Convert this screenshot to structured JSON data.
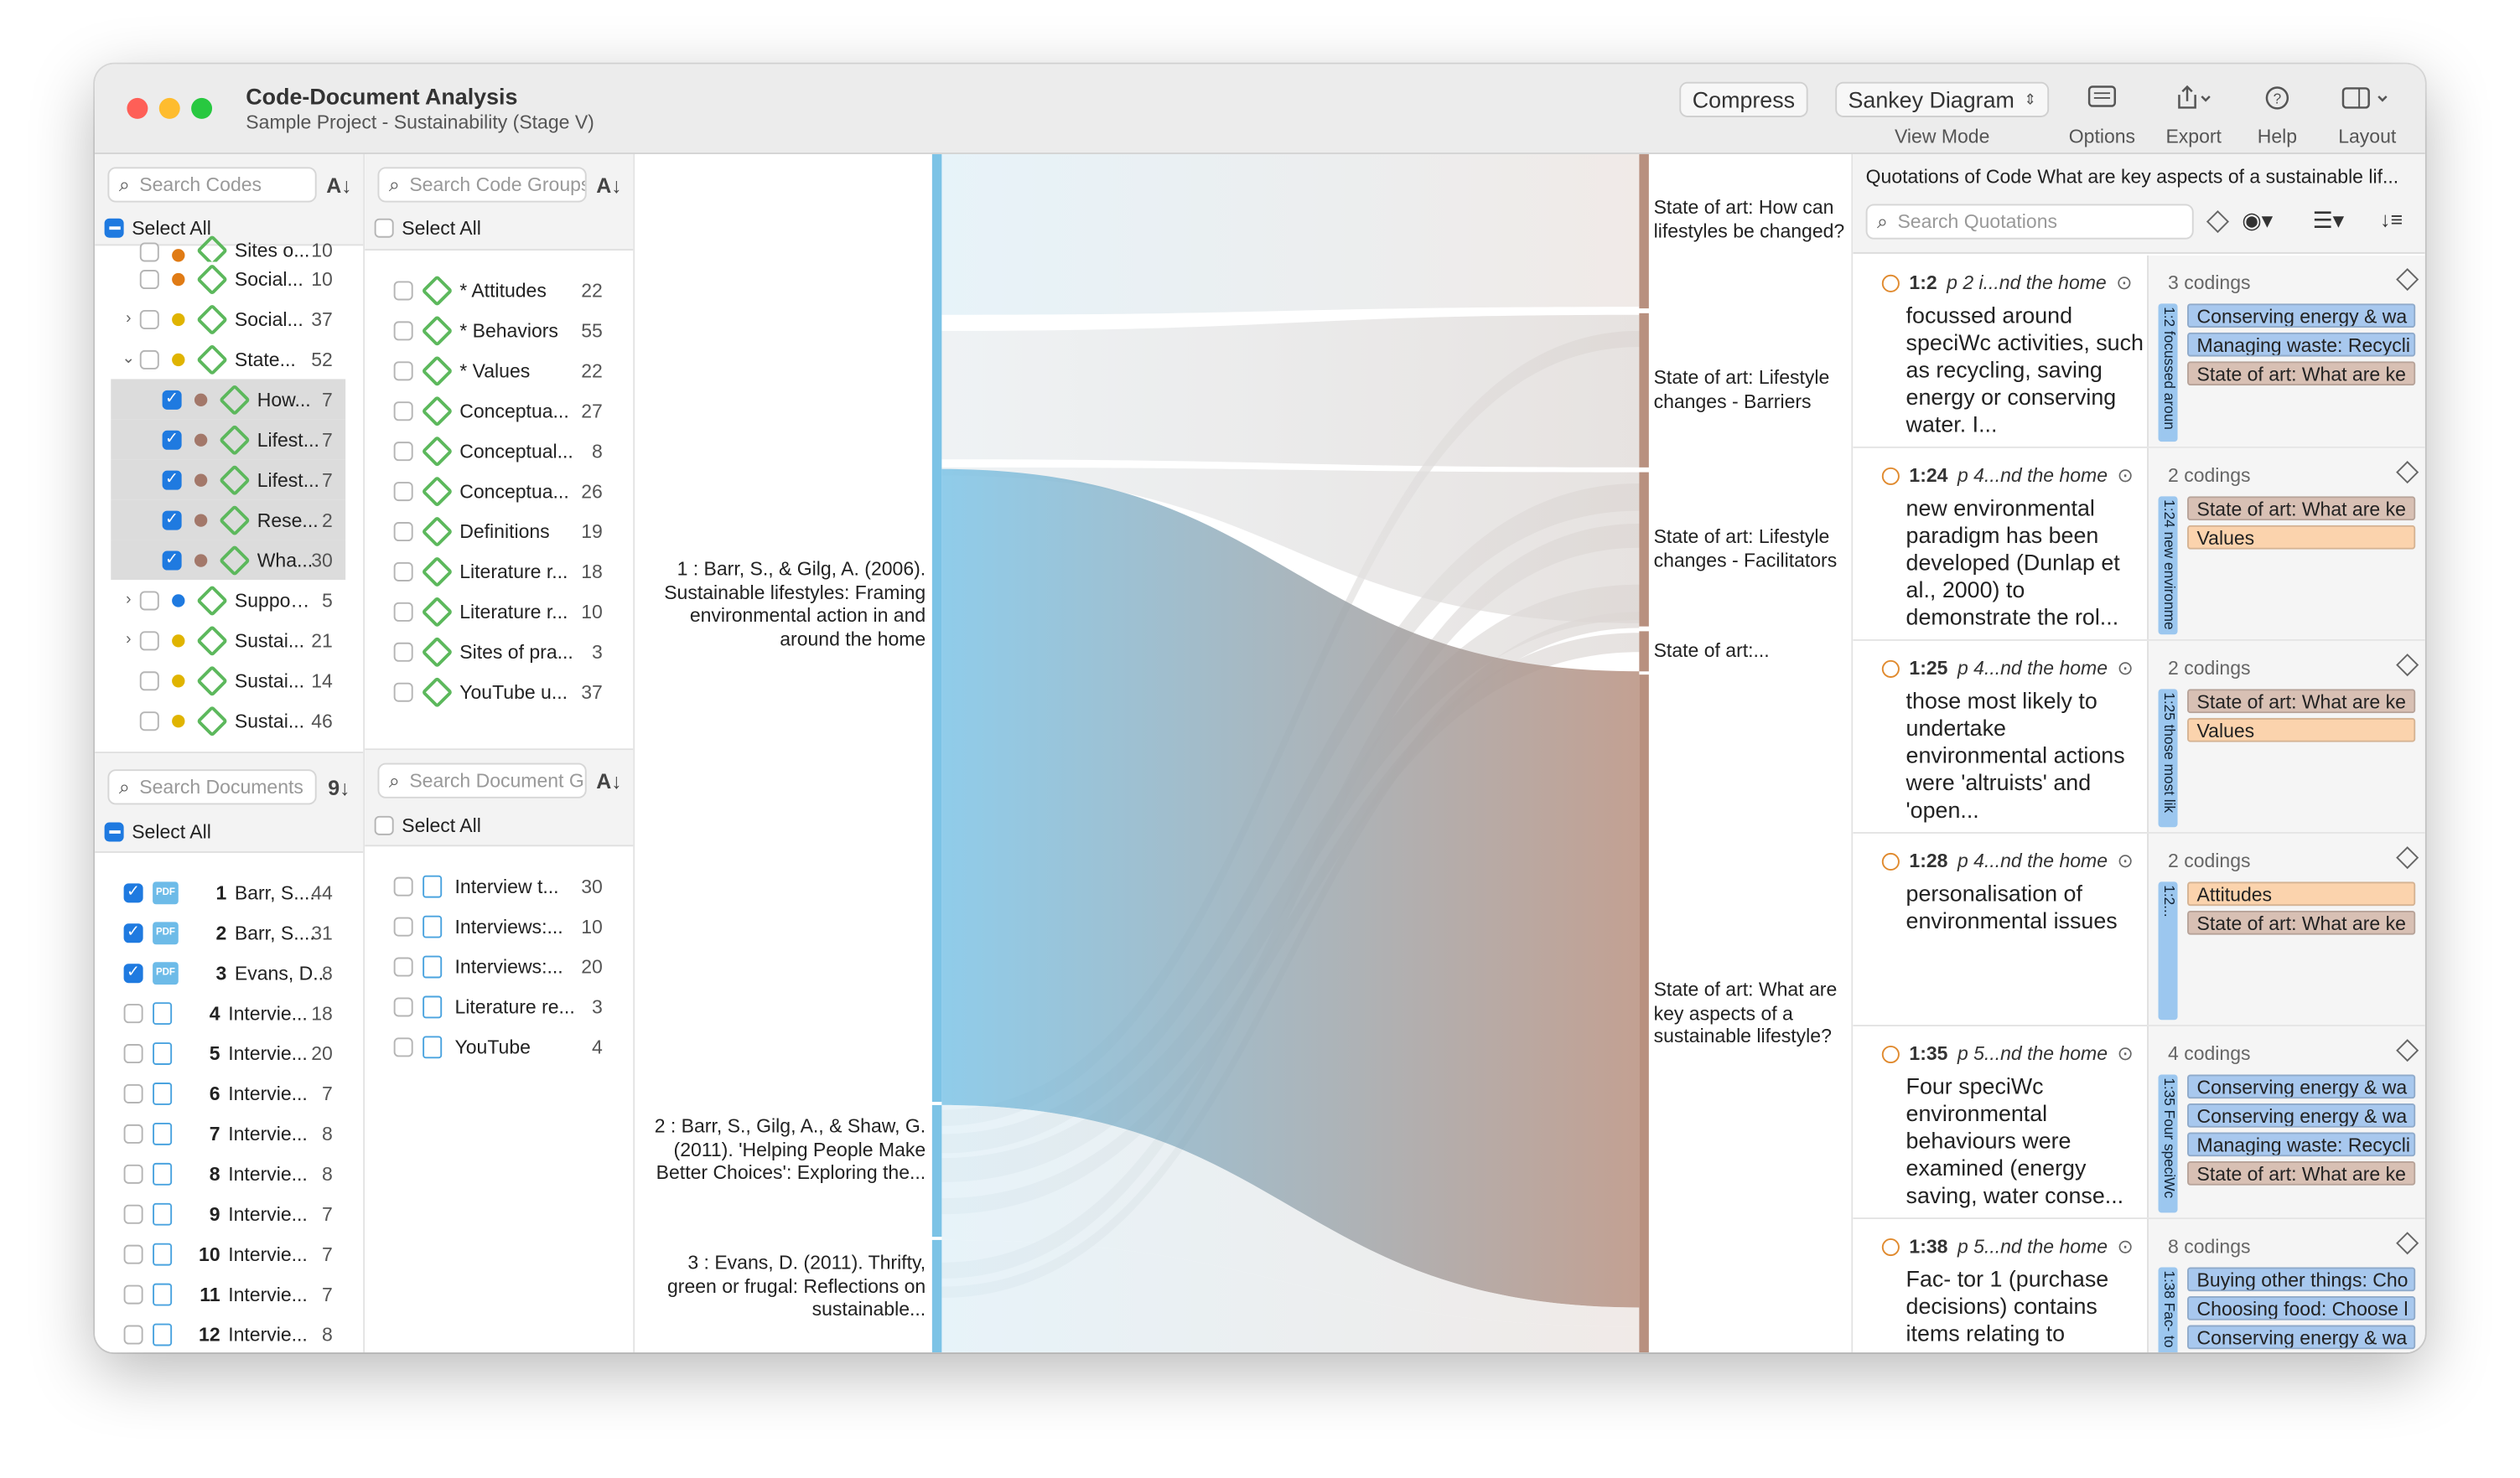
{
  "window": {
    "title": "Code-Document Analysis",
    "subtitle": "Sample Project - Sustainability (Stage V)"
  },
  "toolbar": {
    "compress": "Compress",
    "view_mode_value": "Sankey Diagram",
    "view_mode_label": "View Mode",
    "options": "Options",
    "export": "Export",
    "help": "Help",
    "layout": "Layout"
  },
  "codes_panel": {
    "search_placeholder": "Search Codes",
    "select_all": "Select All",
    "items": [
      {
        "label": "Sites o...",
        "count": "10"
      },
      {
        "label": "Social...",
        "count": "10"
      },
      {
        "label": "Social...",
        "count": "37"
      },
      {
        "label": "State...",
        "count": "52"
      },
      {
        "label": "How...",
        "count": "7"
      },
      {
        "label": "Lifest...",
        "count": "7"
      },
      {
        "label": "Lifest...",
        "count": "7"
      },
      {
        "label": "Rese...",
        "count": "2"
      },
      {
        "label": "Wha...",
        "count": "30"
      },
      {
        "label": "Support...",
        "count": "5"
      },
      {
        "label": "Sustai...",
        "count": "21"
      },
      {
        "label": "Sustai...",
        "count": "14"
      },
      {
        "label": "Sustai...",
        "count": "46"
      }
    ]
  },
  "code_groups_panel": {
    "search_placeholder": "Search Code Groups",
    "select_all": "Select All",
    "items": [
      {
        "label": "* Attitudes",
        "count": "22"
      },
      {
        "label": "* Behaviors",
        "count": "55"
      },
      {
        "label": "* Values",
        "count": "22"
      },
      {
        "label": "Conceptua...",
        "count": "27"
      },
      {
        "label": "Conceptual...",
        "count": "8"
      },
      {
        "label": "Conceptua...",
        "count": "26"
      },
      {
        "label": "Definitions",
        "count": "19"
      },
      {
        "label": "Literature r...",
        "count": "18"
      },
      {
        "label": "Literature r...",
        "count": "10"
      },
      {
        "label": "Sites of pra...",
        "count": "3"
      },
      {
        "label": "YouTube u...",
        "count": "37"
      }
    ]
  },
  "documents_panel": {
    "search_placeholder": "Search Documents",
    "select_all": "Select All",
    "items": [
      {
        "num": "1",
        "label": "Barr, S....",
        "count": "44"
      },
      {
        "num": "2",
        "label": "Barr, S....",
        "count": "31"
      },
      {
        "num": "3",
        "label": "Evans, D...",
        "count": "8"
      },
      {
        "num": "4",
        "label": "Intervie...",
        "count": "18"
      },
      {
        "num": "5",
        "label": "Intervie...",
        "count": "20"
      },
      {
        "num": "6",
        "label": "Intervie...",
        "count": "7"
      },
      {
        "num": "7",
        "label": "Intervie...",
        "count": "8"
      },
      {
        "num": "8",
        "label": "Intervie...",
        "count": "8"
      },
      {
        "num": "9",
        "label": "Intervie...",
        "count": "7"
      },
      {
        "num": "10",
        "label": "Intervie...",
        "count": "7"
      },
      {
        "num": "11",
        "label": "Intervie...",
        "count": "7"
      },
      {
        "num": "12",
        "label": "Intervie...",
        "count": "8"
      }
    ]
  },
  "doc_groups_panel": {
    "search_placeholder": "Search Document Groups",
    "select_all": "Select All",
    "items": [
      {
        "label": "Interview t...",
        "count": "30"
      },
      {
        "label": "Interviews:...",
        "count": "10"
      },
      {
        "label": "Interviews:...",
        "count": "20"
      },
      {
        "label": "Literature re...",
        "count": "3"
      },
      {
        "label": "YouTube",
        "count": "4"
      }
    ]
  },
  "sankey": {
    "left_nodes": [
      "1 : Barr, S., & Gilg, A. (2006). Sustainable lifestyles: Framing environmental action in and around the home",
      "2 : Barr, S., Gilg, A., & Shaw, G. (2011). 'Helping People Make Better Choices': Exploring the...",
      "3 : Evans, D. (2011). Thrifty, green or frugal: Reflections on sustainable..."
    ],
    "right_nodes": [
      "State of art: How can lifestyles be changed?",
      "State of art: Lifestyle changes - Barriers",
      "State of art: Lifestyle changes - Facilitators",
      "State of art:...",
      "State of art: What are key aspects of a sustainable lifestyle?"
    ],
    "colors": {
      "left": "#7cc3e6",
      "right": "#b8907f"
    }
  },
  "quotations": {
    "header": "Quotations of Code What are key aspects of a sustainable lif...",
    "search_placeholder": "Search Quotations",
    "items": [
      {
        "id": "1:2",
        "head": "p 2 i...nd the home",
        "text": "focussed around speciWc activities, such as recycling, saving energy or conserving water. I...",
        "side": "1:2 focussed aroun",
        "codings": "3 codings",
        "tags": [
          {
            "text": "Conserving energy & wa",
            "color": "blue"
          },
          {
            "text": "Managing waste: Recycli",
            "color": "blue"
          },
          {
            "text": "State of art: What are ke",
            "color": "brown"
          }
        ]
      },
      {
        "id": "1:24",
        "head": "p 4...nd the home",
        "text": "new environmental paradigm has been developed (Dunlap et al., 2000) to demonstrate the rol...",
        "side": "1:24 new environme",
        "codings": "2 codings",
        "tags": [
          {
            "text": "State of art: What are ke",
            "color": "brown"
          },
          {
            "text": "Values",
            "color": "orange"
          }
        ]
      },
      {
        "id": "1:25",
        "head": "p 4...nd the home",
        "text": "those most likely to undertake environmental actions were 'altruists' and 'open...",
        "side": "1:25 those most lik",
        "codings": "2 codings",
        "tags": [
          {
            "text": "State of art: What are ke",
            "color": "brown"
          },
          {
            "text": "Values",
            "color": "orange"
          }
        ]
      },
      {
        "id": "1:28",
        "head": "p 4...nd the home",
        "text": "personalisation of environmental issues",
        "side": "1:2...",
        "codings": "2 codings",
        "tags": [
          {
            "text": "Attitudes",
            "color": "orange"
          },
          {
            "text": "State of art: What are ke",
            "color": "brown"
          }
        ]
      },
      {
        "id": "1:35",
        "head": "p 5...nd the home",
        "text": "Four speciWc environmental behaviours were examined (energy saving, water conse...",
        "side": "1:35 Four speciWc",
        "codings": "4 codings",
        "tags": [
          {
            "text": "Conserving energy & wa",
            "color": "blue"
          },
          {
            "text": "Conserving energy & wa",
            "color": "blue"
          },
          {
            "text": "Managing waste: Recycli",
            "color": "blue"
          },
          {
            "text": "State of art: What are ke",
            "color": "brown"
          }
        ]
      },
      {
        "id": "1:38",
        "head": "p 5...nd the home",
        "text": "Fac- tor 1 (purchase decisions) contains items relating to",
        "side": "1:38 Fac- to",
        "codings": "8 codings",
        "tags": [
          {
            "text": "Buying other things: Cho",
            "color": "blue"
          },
          {
            "text": "Choosing food: Choose l",
            "color": "blue"
          },
          {
            "text": "Conserving energy & wa",
            "color": "blue"
          }
        ]
      }
    ]
  }
}
